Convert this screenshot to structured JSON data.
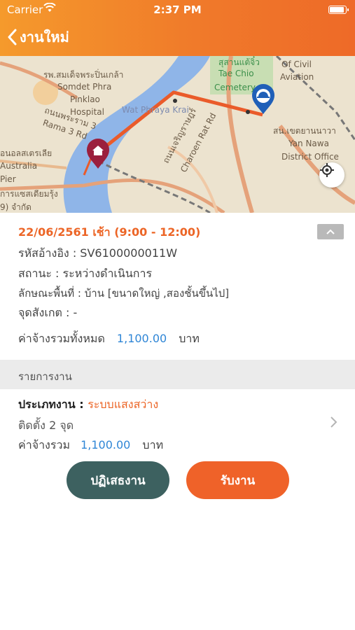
{
  "status_bar": {
    "carrier": "Carrier",
    "time": "2:37 PM"
  },
  "nav": {
    "title": "งานใหม่",
    "icon": "chevron-left-icon"
  },
  "map": {
    "labels": [
      "รพ.สมเด็จพระปิ่นเกล้า",
      "Somdet Phra",
      "Pinklao",
      "Hospital",
      "สุสานแต้จิ๋ว",
      "Tae Chio",
      "Cemetery",
      "Of Civil",
      "Aviation",
      "Wat Phraya Krai",
      "สน.เขตยานนาวา",
      "Yan Nawa",
      "District Office",
      "ถนนเจริญราษฎร์",
      "Charoen Rat Rd",
      "ถนนพระราม 3",
      "Rama 3 Rd",
      "อนอลสเตรเลีย",
      "Australia",
      "Pier",
      "การแซสเดียมรุ้ง",
      "9) จำกัด"
    ],
    "home_marker_icon": "home-pin-icon",
    "worker_marker_icon": "worker-helmet-pin-icon",
    "locate_icon": "crosshair-icon"
  },
  "detail": {
    "date": "22/06/2561 เช้า (9:00 - 12:00)",
    "ref_label": "รหัสอ้างอิง : ",
    "ref_value": "SV6100000011W",
    "status_label": "สถานะ : ",
    "status_value": "ระหว่างดำเนินการ",
    "area_label": "ลักษณะพื้นที่ : ",
    "area_value": "บ้าน [ขนาดใหญ่ ,สองชั้นขึ้นไป]",
    "landmark_label": "จุดสังเกต : ",
    "landmark_value": "-",
    "total_label": "ค่าจ้างรวมทั้งหมด",
    "total_value": "1,100.00",
    "currency": "บาท",
    "collapse_icon": "chevron-up-icon"
  },
  "section": {
    "title": "รายการงาน"
  },
  "job": {
    "type_label": "ประเภทงาน : ",
    "type_value": "ระบบแสงสว่าง",
    "install": "ติดตั้ง 2 จุด",
    "fee_label": "ค่าจ้างรวม",
    "fee_value": "1,100.00",
    "currency": "บาท",
    "chevron_icon": "chevron-right-icon"
  },
  "actions": {
    "reject": "ปฏิเสธงาน",
    "accept": "รับงาน"
  },
  "colors": {
    "accent": "#ec6526",
    "reject": "#3d6160",
    "link": "#2f86d6"
  }
}
